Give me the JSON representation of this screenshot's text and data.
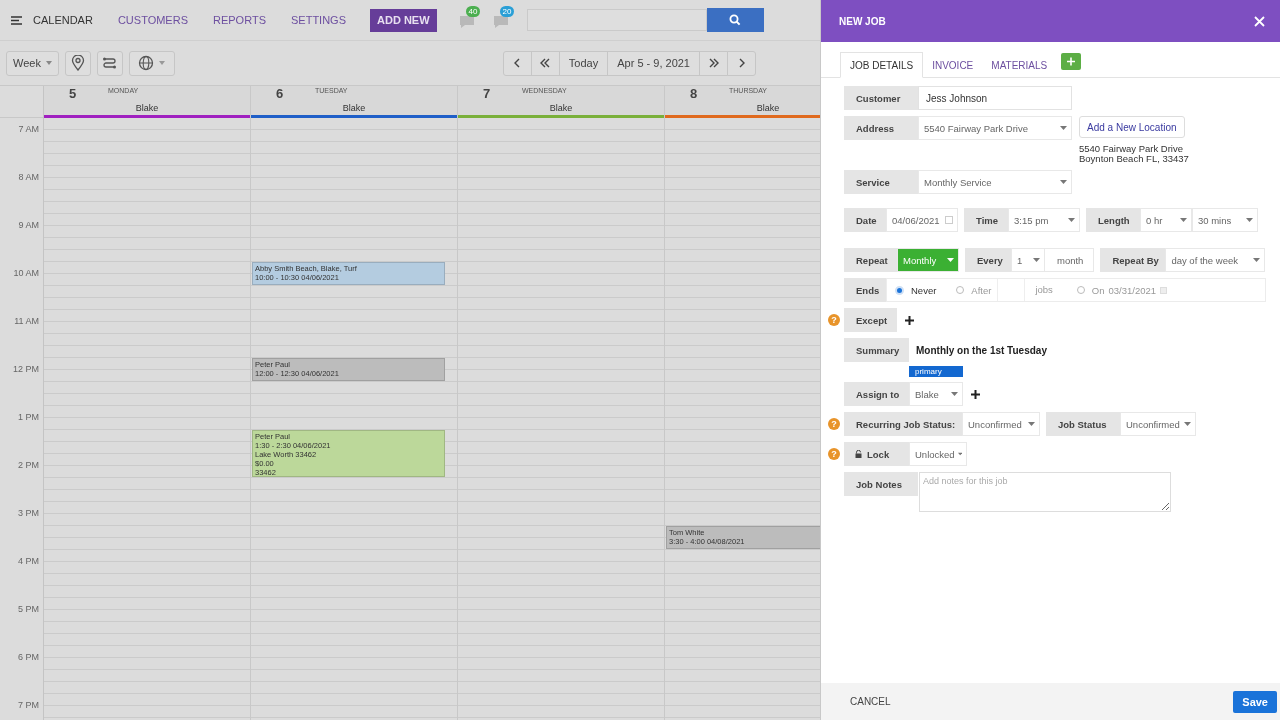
{
  "nav": {
    "items": [
      {
        "label": "CALENDAR",
        "selected": true
      },
      {
        "label": "CUSTOMERS",
        "selected": false
      },
      {
        "label": "REPORTS",
        "selected": false
      },
      {
        "label": "SETTINGS",
        "selected": false
      }
    ],
    "add_new": "ADD NEW",
    "badges": [
      {
        "count": "40",
        "color": "#4caf50"
      },
      {
        "count": "20",
        "color": "#2a9fd6"
      }
    ]
  },
  "toolbar": {
    "view": "Week",
    "today": "Today",
    "range": "Apr 5 - 9, 2021"
  },
  "hours": [
    "7 AM",
    "8 AM",
    "9 AM",
    "10 AM",
    "11 AM",
    "12 PM",
    "1 PM",
    "2 PM",
    "3 PM",
    "4 PM",
    "5 PM",
    "6 PM",
    "7 PM"
  ],
  "days": [
    {
      "date": "5",
      "weekday": "MONDAY",
      "staff": "Blake",
      "color": "#a020c0"
    },
    {
      "date": "6",
      "weekday": "TUESDAY",
      "staff": "Blake",
      "color": "#1f5fc8",
      "events": [
        {
          "color": "#b4cce0",
          "lines": [
            "Abby Smith Beach, Blake, Turf",
            "10:00 - 10:30 04/06/2021"
          ]
        },
        {
          "color": "#bcbcbc",
          "lines": [
            "Peter Paul",
            "12:00 - 12:30 04/06/2021"
          ]
        },
        {
          "color": "#bcd89a",
          "lines": [
            "Peter Paul",
            "1:30 - 2:30 04/06/2021",
            "Lake Worth 33462",
            "$0.00",
            "33462"
          ]
        }
      ]
    },
    {
      "date": "7",
      "weekday": "WEDNESDAY",
      "staff": "Blake",
      "color": "#7ab03a"
    },
    {
      "date": "8",
      "weekday": "THURSDAY",
      "staff": "Blake",
      "color": "#e06a1e",
      "events": [
        {
          "color": "#bcbcbc",
          "lines": [
            "Tom White",
            "3:30 - 4:00 04/08/2021"
          ]
        }
      ]
    }
  ],
  "panel": {
    "title": "NEW JOB",
    "tabs": [
      {
        "label": "JOB DETAILS",
        "selected": true
      },
      {
        "label": "INVOICE",
        "selected": false
      },
      {
        "label": "MATERIALS",
        "selected": false
      }
    ],
    "customer": {
      "label": "Customer",
      "value": "Jess Johnson"
    },
    "address": {
      "label": "Address",
      "value": "5540 Fairway Park Drive",
      "button": "Add a New Location",
      "lines": [
        "5540 Fairway Park Drive",
        "Boynton Beach FL, 33437"
      ]
    },
    "service": {
      "label": "Service",
      "value": "Monthly Service"
    },
    "date": {
      "label": "Date",
      "value": "04/06/2021"
    },
    "time": {
      "label": "Time",
      "value": "3:15 pm"
    },
    "length": {
      "label": "Length",
      "hours": "0 hr",
      "minutes": "30 mins"
    },
    "repeat": {
      "label": "Repeat",
      "value": "Monthly"
    },
    "every": {
      "label": "Every",
      "value": "1",
      "unit": "month"
    },
    "repeat_by": {
      "label": "Repeat By",
      "value": "day of the week"
    },
    "ends": {
      "label": "Ends",
      "never": {
        "label": "Never",
        "selected": true
      },
      "after": {
        "label": "After",
        "selected": false,
        "unit": "jobs"
      },
      "on": {
        "label": "On",
        "selected": false,
        "value": "03/31/2021"
      }
    },
    "except": {
      "label": "Except",
      "help": "?"
    },
    "summary": {
      "label": "Summary",
      "value": "Monthly on the 1st Tuesday"
    },
    "assign": {
      "label": "Assign to",
      "tag": "primary",
      "value": "Blake"
    },
    "recurring_status": {
      "label": "Recurring Job Status:",
      "value": "Unconfirmed",
      "help": "?"
    },
    "job_status": {
      "label": "Job Status",
      "value": "Unconfirmed"
    },
    "lock": {
      "label": "Lock",
      "value": "Unlocked",
      "help": "?"
    },
    "notes": {
      "label": "Job Notes",
      "placeholder": "Add notes for this job"
    },
    "cancel": "CANCEL",
    "save": "Save"
  }
}
